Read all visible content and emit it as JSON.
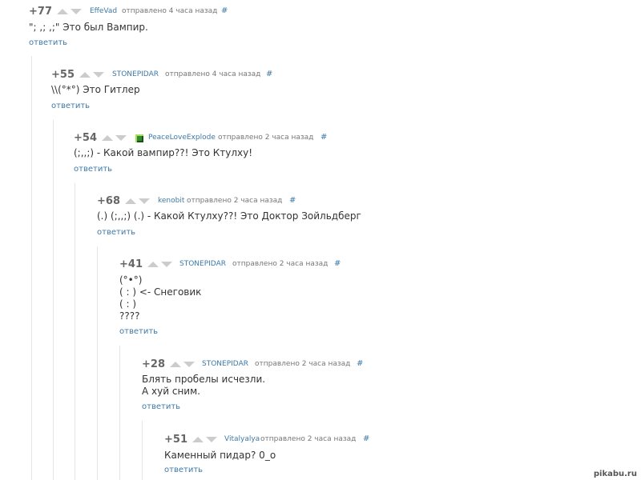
{
  "comments": [
    {
      "rating": "+77",
      "user": "EffeVad",
      "posted": "отправлено 4 часа назад",
      "hash": "#",
      "text": "\"; ,; ,;\" Это был Вампир.",
      "reply": "ответить"
    },
    {
      "rating": "+55",
      "user": "STONEPIDAR",
      "posted": "отправлено 4 часа назад",
      "hash": "#",
      "text": "\\\\(°*°) Это Гитлер",
      "reply": "ответить"
    },
    {
      "rating": "+54",
      "user": "PeaceLoveExplode",
      "posted": "отправлено 2 часа назад",
      "hash": "#",
      "text": "(;,,;) - Какой вампир??! Это Ктулху!",
      "reply": "ответить"
    },
    {
      "rating": "+68",
      "user": "kenobit",
      "posted": "отправлено 2 часа назад",
      "hash": "#",
      "text": "(.) (;,,;) (.) - Какой Ктулху??! Это Доктор Зойльдберг",
      "reply": "ответить"
    },
    {
      "rating": "+41",
      "user": "STONEPIDAR",
      "posted": "отправлено 2 часа назад",
      "hash": "#",
      "text": "(°•°)\n( : ) <- Снеговик\n( : )\n????",
      "reply": "ответить"
    },
    {
      "rating": "+28",
      "user": "STONEPIDAR",
      "posted": "отправлено 2 часа назад",
      "hash": "#",
      "text": "Блять пробелы исчезли.\nА хуй сним.",
      "reply": "ответить"
    },
    {
      "rating": "+51",
      "user": "Vitalyalya",
      "posted": "отправлено 2 часа назад",
      "hash": "#",
      "text": "Каменный пидар? 0_о",
      "reply": "ответить"
    }
  ],
  "watermark": "pikabu.ru",
  "colors": {
    "link": "#3e79a7",
    "rating": "#666666",
    "arrow": "#cccccc",
    "thread_line": "#dfe6ec"
  }
}
